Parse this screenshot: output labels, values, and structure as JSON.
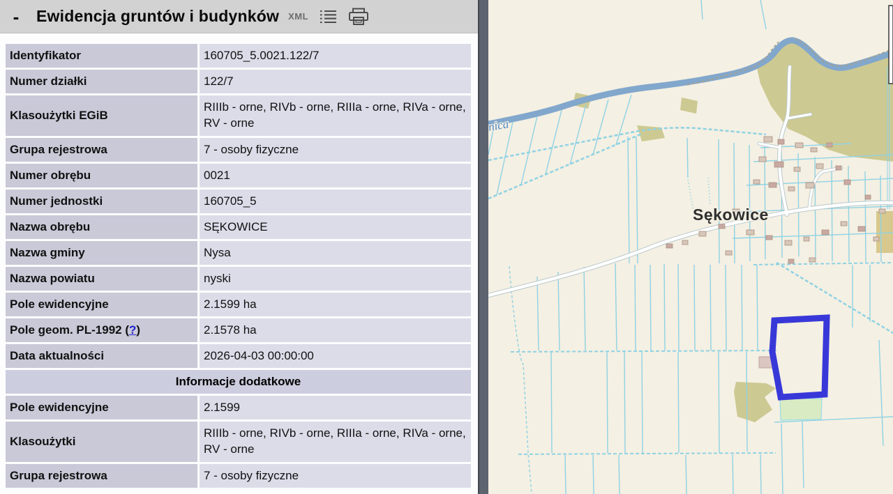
{
  "panel": {
    "header": {
      "minimize": "-",
      "title": "Ewidencja gruntów i budynków"
    },
    "toolbar": {
      "xml": "XML",
      "list_icon": "list-icon",
      "print_icon": "printer-icon"
    },
    "rows": [
      {
        "label": "Identyfikator",
        "value": "160705_5.0021.122/7"
      },
      {
        "label": "Numer działki",
        "value": "122/7"
      },
      {
        "label": "Klasoużytki EGiB",
        "value": "RIIIb - orne, RIVb - orne, RIIIa - orne, RIVa - orne, RV - orne"
      },
      {
        "label": "Grupa rejestrowa",
        "value": "7 - osoby fizyczne"
      },
      {
        "label": "Numer obrębu",
        "value": "0021"
      },
      {
        "label": "Numer jednostki",
        "value": "160705_5"
      },
      {
        "label": "Nazwa obrębu",
        "value": "SĘKOWICE"
      },
      {
        "label": "Nazwa gminy",
        "value": "Nysa"
      },
      {
        "label": "Nazwa powiatu",
        "value": "nyski"
      },
      {
        "label": "Pole ewidencyjne",
        "value": "2.1599 ha"
      },
      {
        "label_prefix": "Pole geom. PL-1992 (",
        "help_link": "?",
        "label_suffix": ")",
        "value": "2.1578 ha"
      },
      {
        "label": "Data aktualności",
        "value": "2026-04-03 00:00:00"
      }
    ],
    "section_header": "Informacje dodatkowe",
    "extra_rows": [
      {
        "label": "Pole ewidencyjne",
        "value": "2.1599"
      },
      {
        "label": "Klasoużytki",
        "value": "RIIIb - orne, RIVb - orne, RIIIa - orne, RIVa - orne, RV - orne"
      },
      {
        "label": "Grupa rejestrowa",
        "value": "7 - osoby fizyczne"
      }
    ]
  },
  "map": {
    "place_label": "Sękowice",
    "water_label_fragment": "nica",
    "colors": {
      "selected_parcel": "#3838d9",
      "help_link": "#2222cc",
      "map_background": "#f4f0e3",
      "water": "#82a7cc",
      "parcel_line": "#8fd2e4",
      "scrub": "#cdc992",
      "grass": "#d9ebc3",
      "building": "#d7c6ba",
      "road": "#ffffff",
      "panel_label_cell": "#c9c9d8",
      "panel_value_cell": "#dcdce9"
    }
  }
}
